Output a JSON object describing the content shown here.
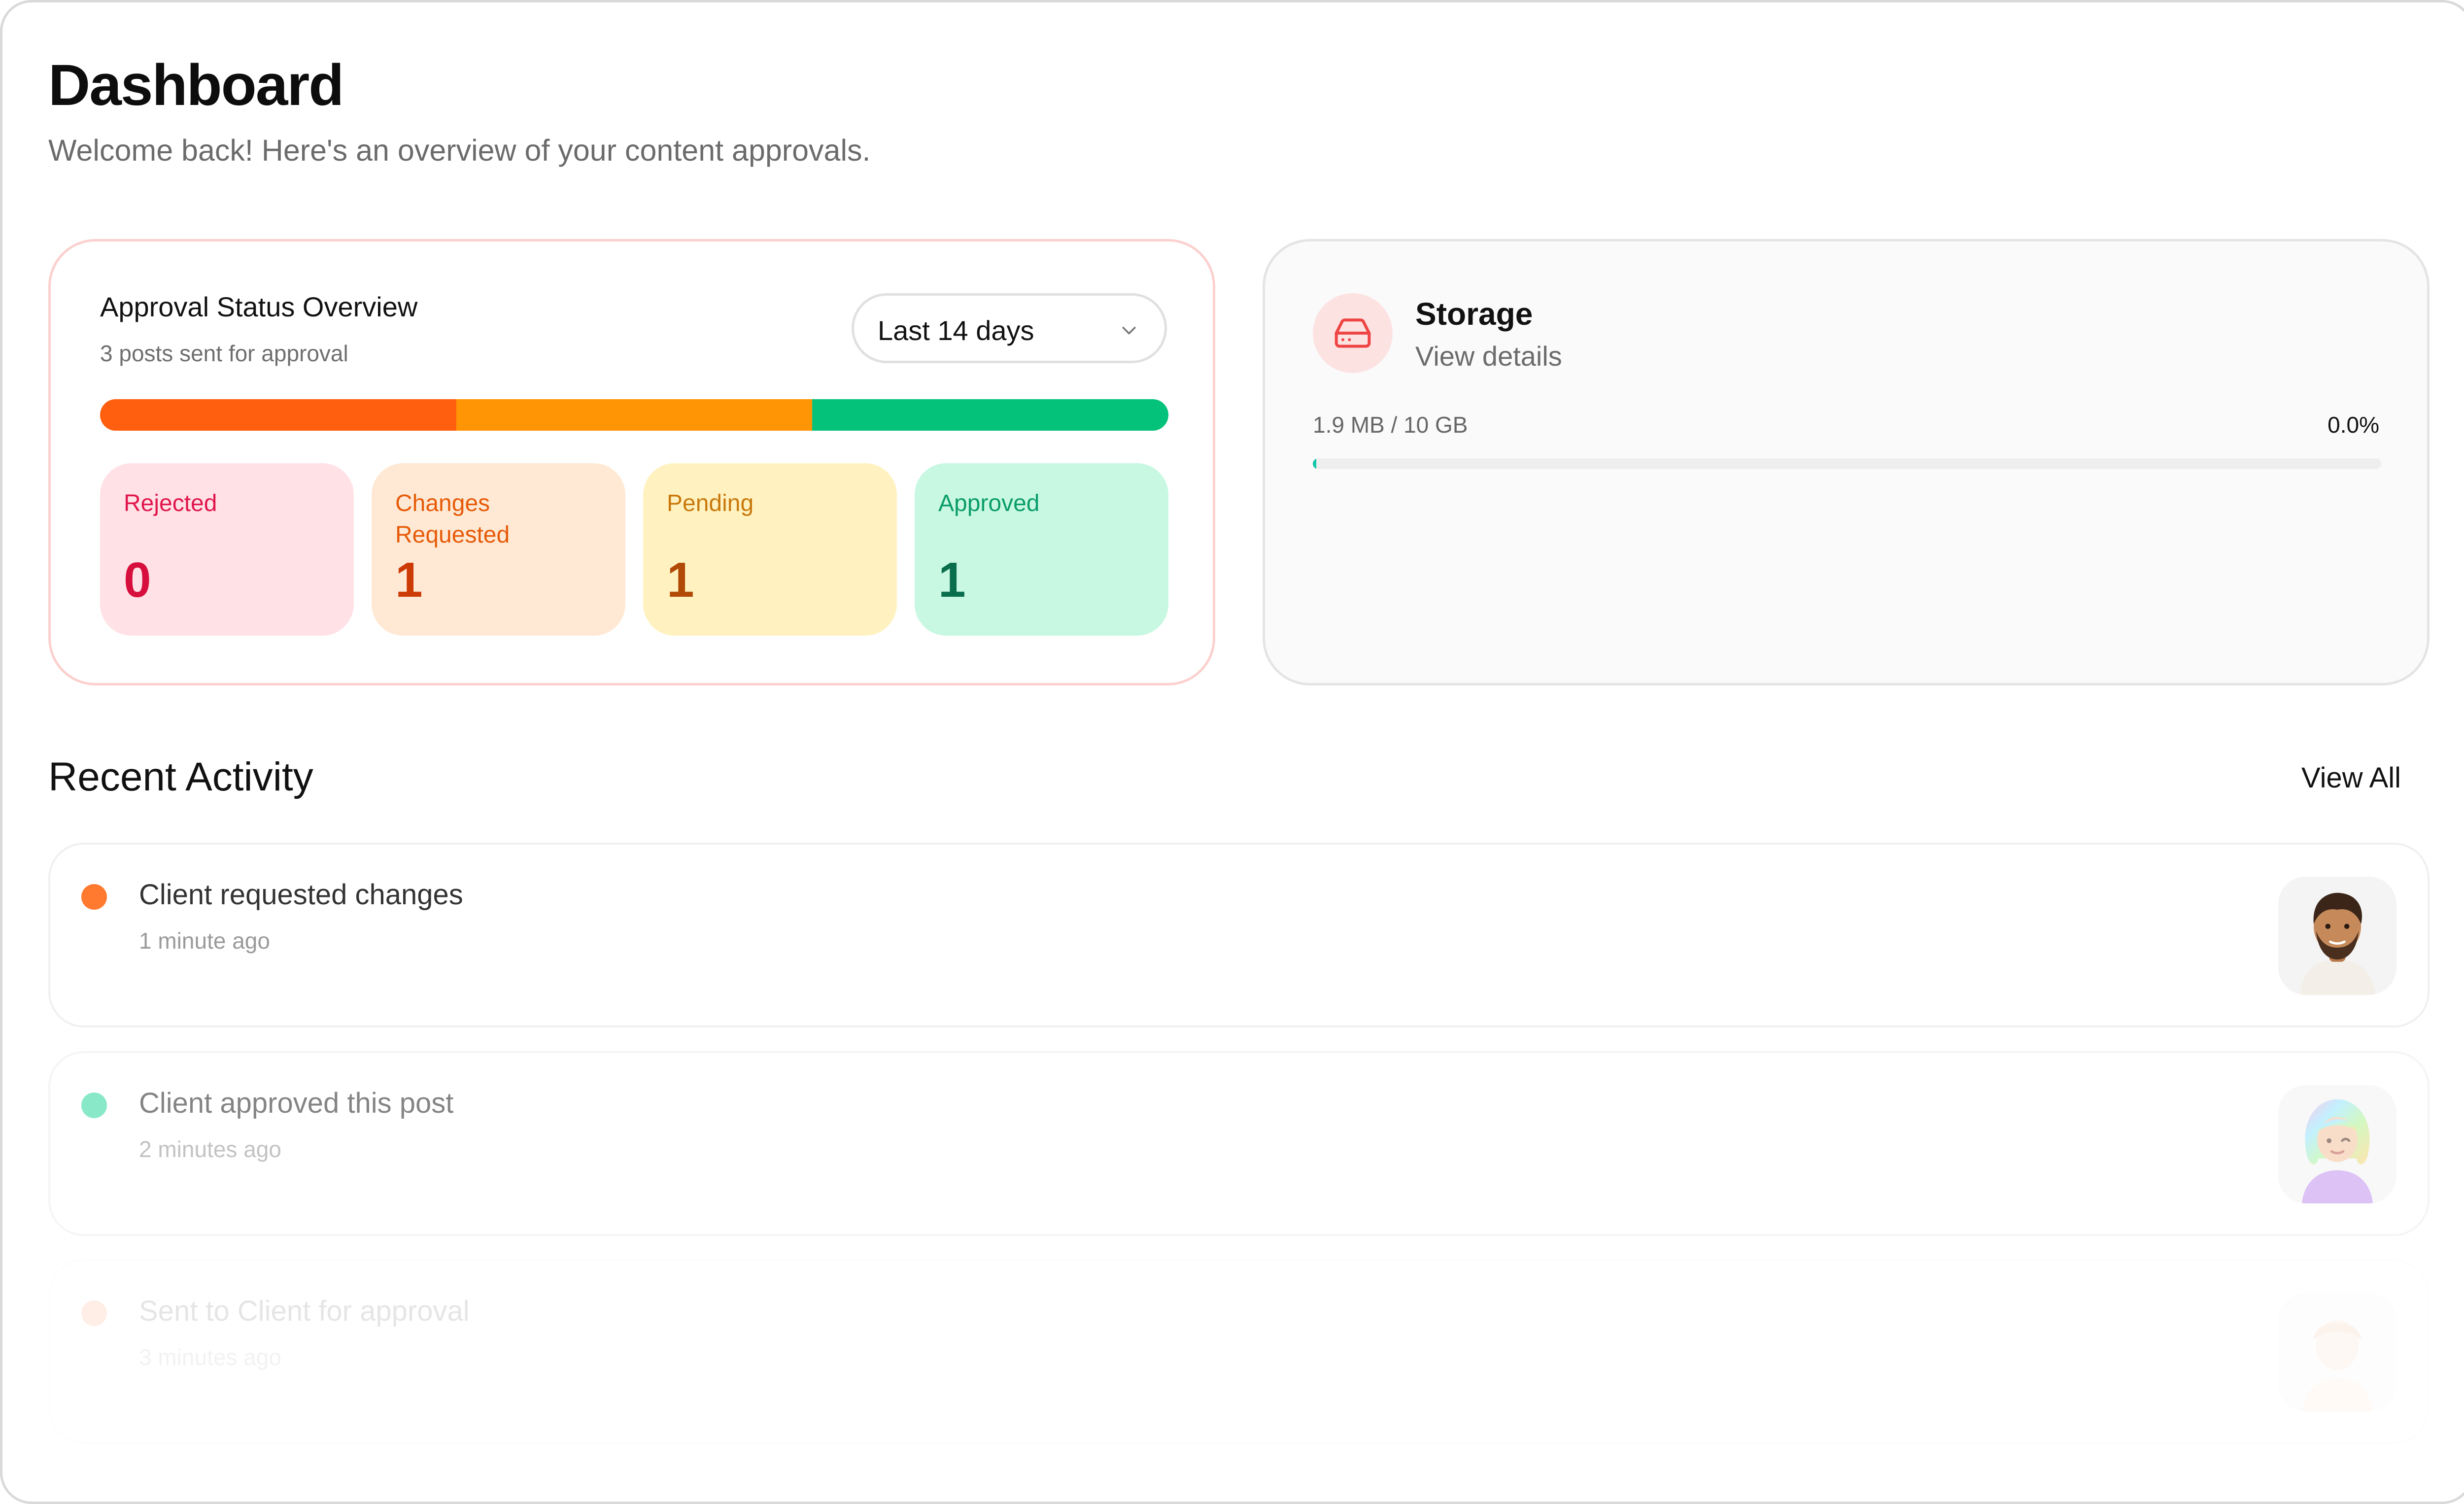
{
  "header": {
    "title": "Dashboard",
    "subtitle": "Welcome back! Here's an overview of your content approvals."
  },
  "approval_overview": {
    "title": "Approval Status Overview",
    "subtitle": "3 posts sent for approval",
    "range_select": {
      "selected": "Last 14 days",
      "icon": "chevron-down-icon"
    },
    "bar_segments": [
      {
        "name": "Changes Requested",
        "fraction": 0.3333,
        "color": "#ff5f0f"
      },
      {
        "name": "Pending",
        "fraction": 0.3333,
        "color": "#ff9505"
      },
      {
        "name": "Approved",
        "fraction": 0.3334,
        "color": "#05c27a"
      }
    ],
    "tiles": [
      {
        "label": "Rejected",
        "count": "0",
        "bg": "#ffe1e6",
        "label_color": "#e0154b",
        "count_color": "#d60f3d"
      },
      {
        "label": "Changes Requested",
        "count": "1",
        "bg": "#ffe9d4",
        "label_color": "#e65a08",
        "count_color": "#cc3a06"
      },
      {
        "label": "Pending",
        "count": "1",
        "bg": "#fff2c0",
        "label_color": "#c9780b",
        "count_color": "#b14a07"
      },
      {
        "label": "Approved",
        "count": "1",
        "bg": "#c8f8e2",
        "label_color": "#0a9c6a",
        "count_color": "#0a6e4c"
      }
    ]
  },
  "storage": {
    "icon": "hard-drive-icon",
    "title": "Storage",
    "link": "View details",
    "usage": "1.9 MB / 10 GB",
    "percent": "0.0%",
    "fill_fraction": 0.003,
    "accent": "#ef4444"
  },
  "recent_activity": {
    "title": "Recent Activity",
    "view_all": "View All",
    "items": [
      {
        "text": "Client requested changes",
        "time": "1 minute ago",
        "dot_color": "#ff7a2f",
        "avatar": "bearded-man-avatar"
      },
      {
        "text": "Client approved this post",
        "time": "2 minutes ago",
        "dot_color": "#3cd9a5",
        "avatar": "rainbow-hair-woman-avatar"
      },
      {
        "text": "Sent to Client for approval",
        "time": "3 minutes ago",
        "dot_color": "#ff7a2f",
        "avatar": "user-avatar"
      }
    ]
  }
}
